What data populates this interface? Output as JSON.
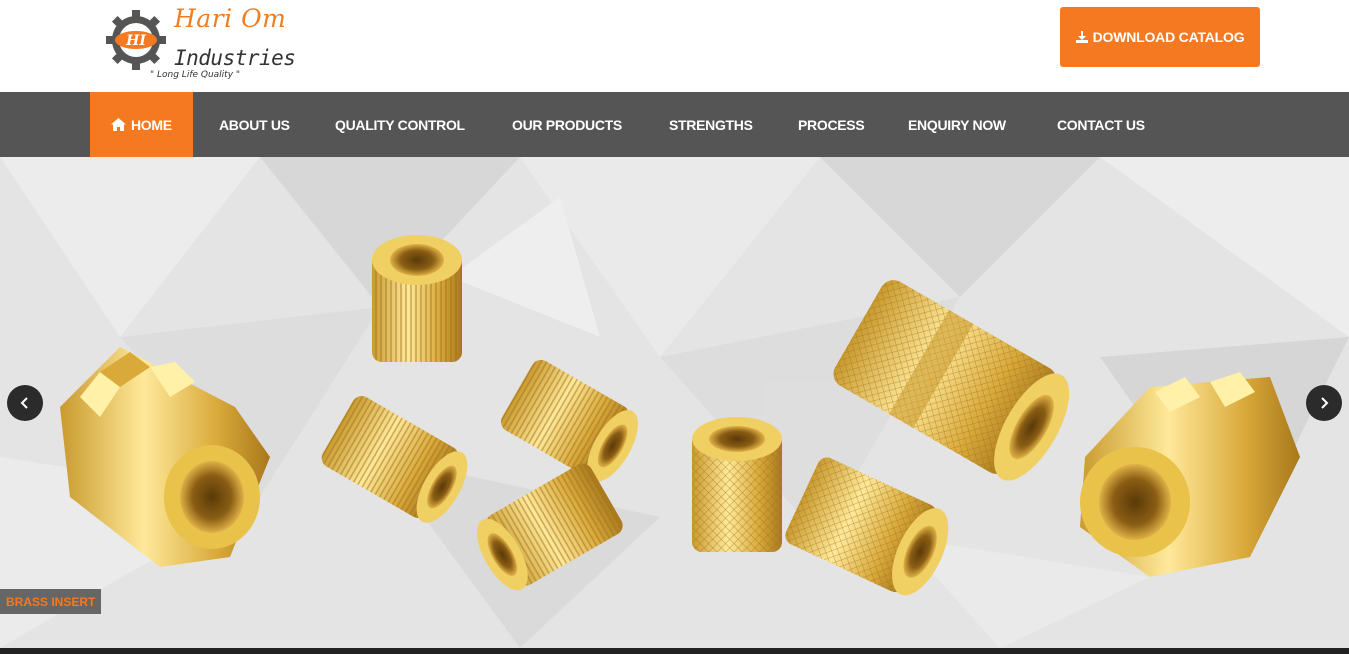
{
  "brand": {
    "monogram": "HI",
    "name": "Hari Om",
    "subtitle": "Industries",
    "tagline": "\" Long Life Quality \""
  },
  "header": {
    "download_label": "DOWNLOAD CATALOG",
    "download_icon": "download-icon"
  },
  "nav": {
    "items": [
      {
        "label": "HOME",
        "icon": "home-icon",
        "active": true
      },
      {
        "label": "ABOUT US"
      },
      {
        "label": "QUALITY CONTROL"
      },
      {
        "label": "OUR PRODUCTS"
      },
      {
        "label": "STRENGTHS"
      },
      {
        "label": "PROCESS"
      },
      {
        "label": "ENQUIRY NOW"
      },
      {
        "label": "CONTACT US"
      }
    ]
  },
  "slider": {
    "caption": "BRASS INSERT",
    "prev_icon": "chevron-left-icon",
    "next_icon": "chevron-right-icon"
  },
  "colors": {
    "accent": "#f47920",
    "nav_bg": "#555555",
    "arrow_bg": "#2b2b2b"
  }
}
